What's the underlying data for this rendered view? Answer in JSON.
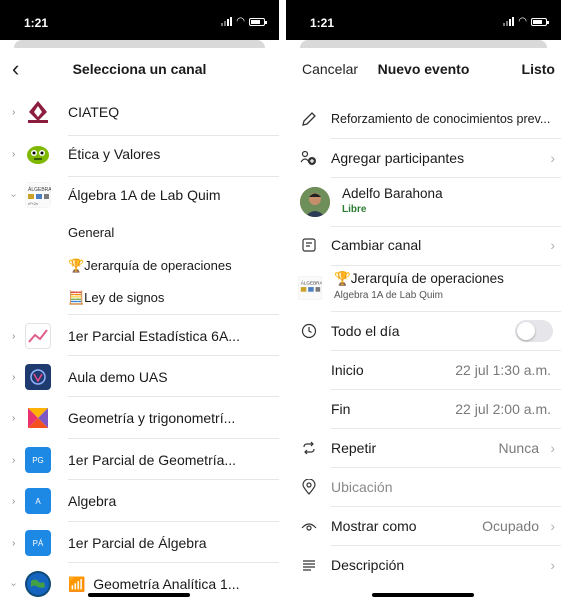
{
  "left": {
    "status_time": "1:21",
    "title": "Selecciona un canal",
    "teams": [
      {
        "name": "CIATEQ",
        "icon": "ciateq-logo-icon",
        "color": "#8b1e3f",
        "abbr": "CIATEC"
      },
      {
        "name": "Ética y Valores",
        "icon": "alien-avatar-icon",
        "color": "#7fb800",
        "abbr": ""
      },
      {
        "name": "Álgebra 1A de Lab Quim",
        "icon": "algebra-image-icon",
        "color": "#f0f0f0",
        "abbr": ""
      }
    ],
    "channels": [
      {
        "name": "General"
      },
      {
        "name": "🏆Jerarquía de operaciones"
      },
      {
        "name": "🧮Ley de signos"
      }
    ],
    "more_teams": [
      {
        "name": "1er Parcial Estadística 6A...",
        "icon": "chart-icon",
        "color": "#ffffff",
        "abbr": ""
      },
      {
        "name": "Aula demo UAS",
        "icon": "uas-logo-icon",
        "color": "#1e3a6e",
        "abbr": ""
      },
      {
        "name": "Geometría y trigonometrí...",
        "icon": "colorful-shapes-icon",
        "color": "#e8336e",
        "abbr": ""
      },
      {
        "name": "1er Parcial de Geometría...",
        "icon": "pg-badge-icon",
        "color": "#1e88e5",
        "abbr": "PG"
      },
      {
        "name": "Algebra",
        "icon": "a-badge-icon",
        "color": "#1e88e5",
        "abbr": "A"
      },
      {
        "name": "1er Parcial de Álgebra",
        "icon": "pa-badge-icon",
        "color": "#1e88e5",
        "abbr": "PÁ"
      },
      {
        "name": "Geometría Analítica 1...",
        "icon": "globe-icon",
        "color": "#0d4a7a",
        "abbr": ""
      }
    ],
    "last_team_emoji": "📶"
  },
  "right": {
    "status_time": "1:21",
    "cancel_label": "Cancelar",
    "title": "Nuevo evento",
    "done_label": "Listo",
    "event_title": "Reforzamiento de conocimientos prev...",
    "add_participants": "Agregar participantes",
    "organizer": {
      "name": "Adelfo Barahona",
      "status": "Libre",
      "status_color": "#2e7d32"
    },
    "change_channel": "Cambiar canal",
    "channel": {
      "name": "🏆Jerarquía de operaciones",
      "team": "Álgebra 1A de Lab Quim"
    },
    "all_day": "Todo el día",
    "start_label": "Inicio",
    "start_value": "22 jul 1:30 a.m.",
    "end_label": "Fin",
    "end_value": "22 jul 2:00 a.m.",
    "repeat_label": "Repetir",
    "repeat_value": "Nunca",
    "location_placeholder": "Ubicación",
    "show_as_label": "Mostrar como",
    "show_as_value": "Ocupado",
    "description_label": "Descripción"
  }
}
